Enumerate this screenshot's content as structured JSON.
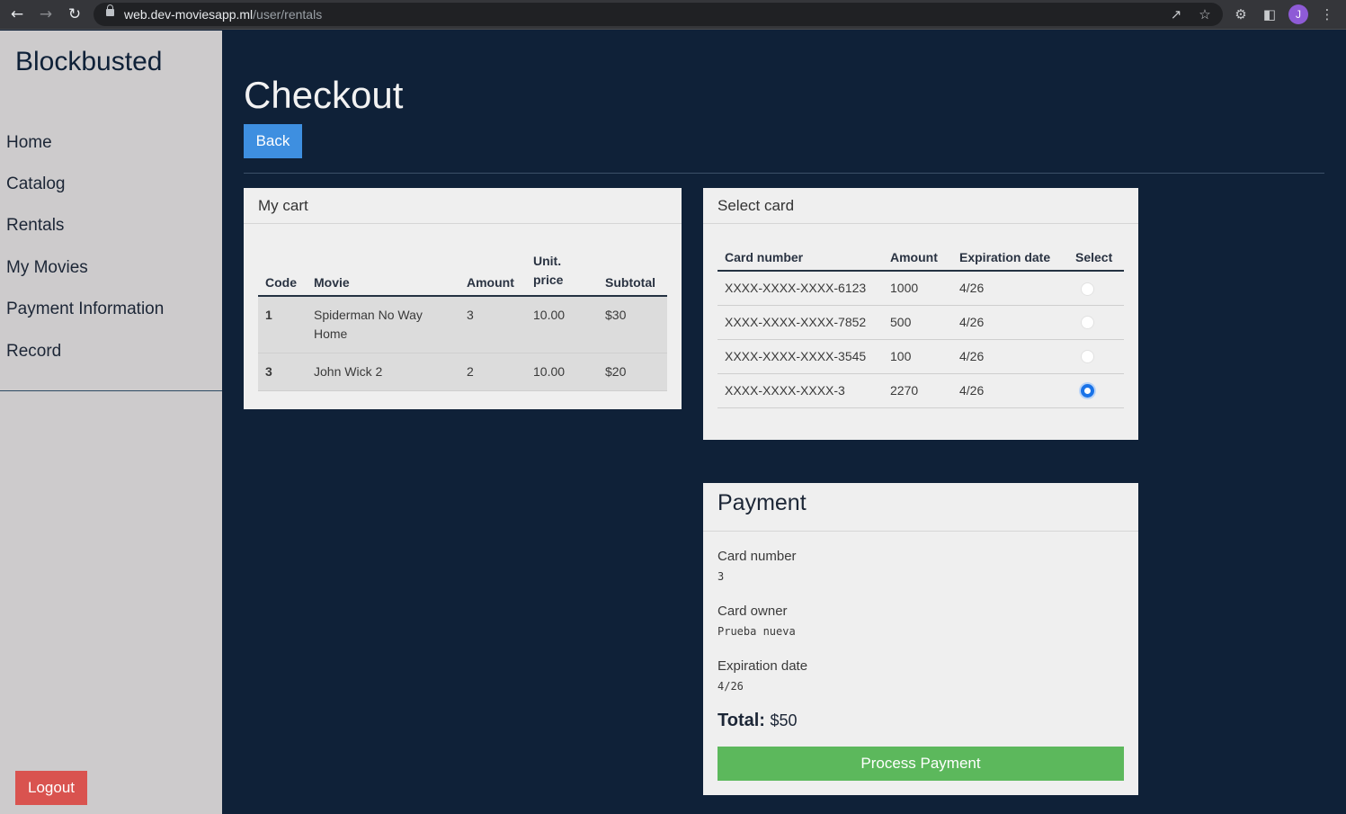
{
  "browser": {
    "url_host": "web.dev-moviesapp.ml",
    "url_path": "/user/rentals",
    "avatar_initial": "J"
  },
  "sidebar": {
    "brand": "Blockbusted",
    "items": [
      {
        "label": "Home"
      },
      {
        "label": "Catalog"
      },
      {
        "label": "Rentals"
      },
      {
        "label": "My Movies"
      },
      {
        "label": "Payment Information"
      },
      {
        "label": "Record"
      }
    ],
    "logout_label": "Logout"
  },
  "main": {
    "title": "Checkout",
    "back_label": "Back"
  },
  "cart": {
    "title": "My cart",
    "columns": [
      "Code",
      "Movie",
      "Amount",
      "Unit. price",
      "Subtotal"
    ],
    "rows": [
      {
        "code": "1",
        "movie": "Spiderman No Way Home",
        "amount": "3",
        "unit_price": "10.00",
        "subtotal": "$30"
      },
      {
        "code": "3",
        "movie": "John Wick 2",
        "amount": "2",
        "unit_price": "10.00",
        "subtotal": "$20"
      }
    ]
  },
  "cards": {
    "title": "Select card",
    "columns": [
      "Card number",
      "Amount",
      "Expiration date",
      "Select"
    ],
    "rows": [
      {
        "number": "XXXX-XXXX-XXXX-6123",
        "amount": "1000",
        "expiration": "4/26",
        "selected": false
      },
      {
        "number": "XXXX-XXXX-XXXX-7852",
        "amount": "500",
        "expiration": "4/26",
        "selected": false
      },
      {
        "number": "XXXX-XXXX-XXXX-3545",
        "amount": "100",
        "expiration": "4/26",
        "selected": false
      },
      {
        "number": "XXXX-XXXX-XXXX-3",
        "amount": "2270",
        "expiration": "4/26",
        "selected": true
      }
    ]
  },
  "payment": {
    "title": "Payment",
    "card_number_label": "Card number",
    "card_number_value": "3",
    "card_owner_label": "Card owner",
    "card_owner_value": "Prueba nueva",
    "expiration_label": "Expiration date",
    "expiration_value": "4/26",
    "total_label": "Total:",
    "total_value": "$50",
    "process_label": "Process Payment"
  }
}
